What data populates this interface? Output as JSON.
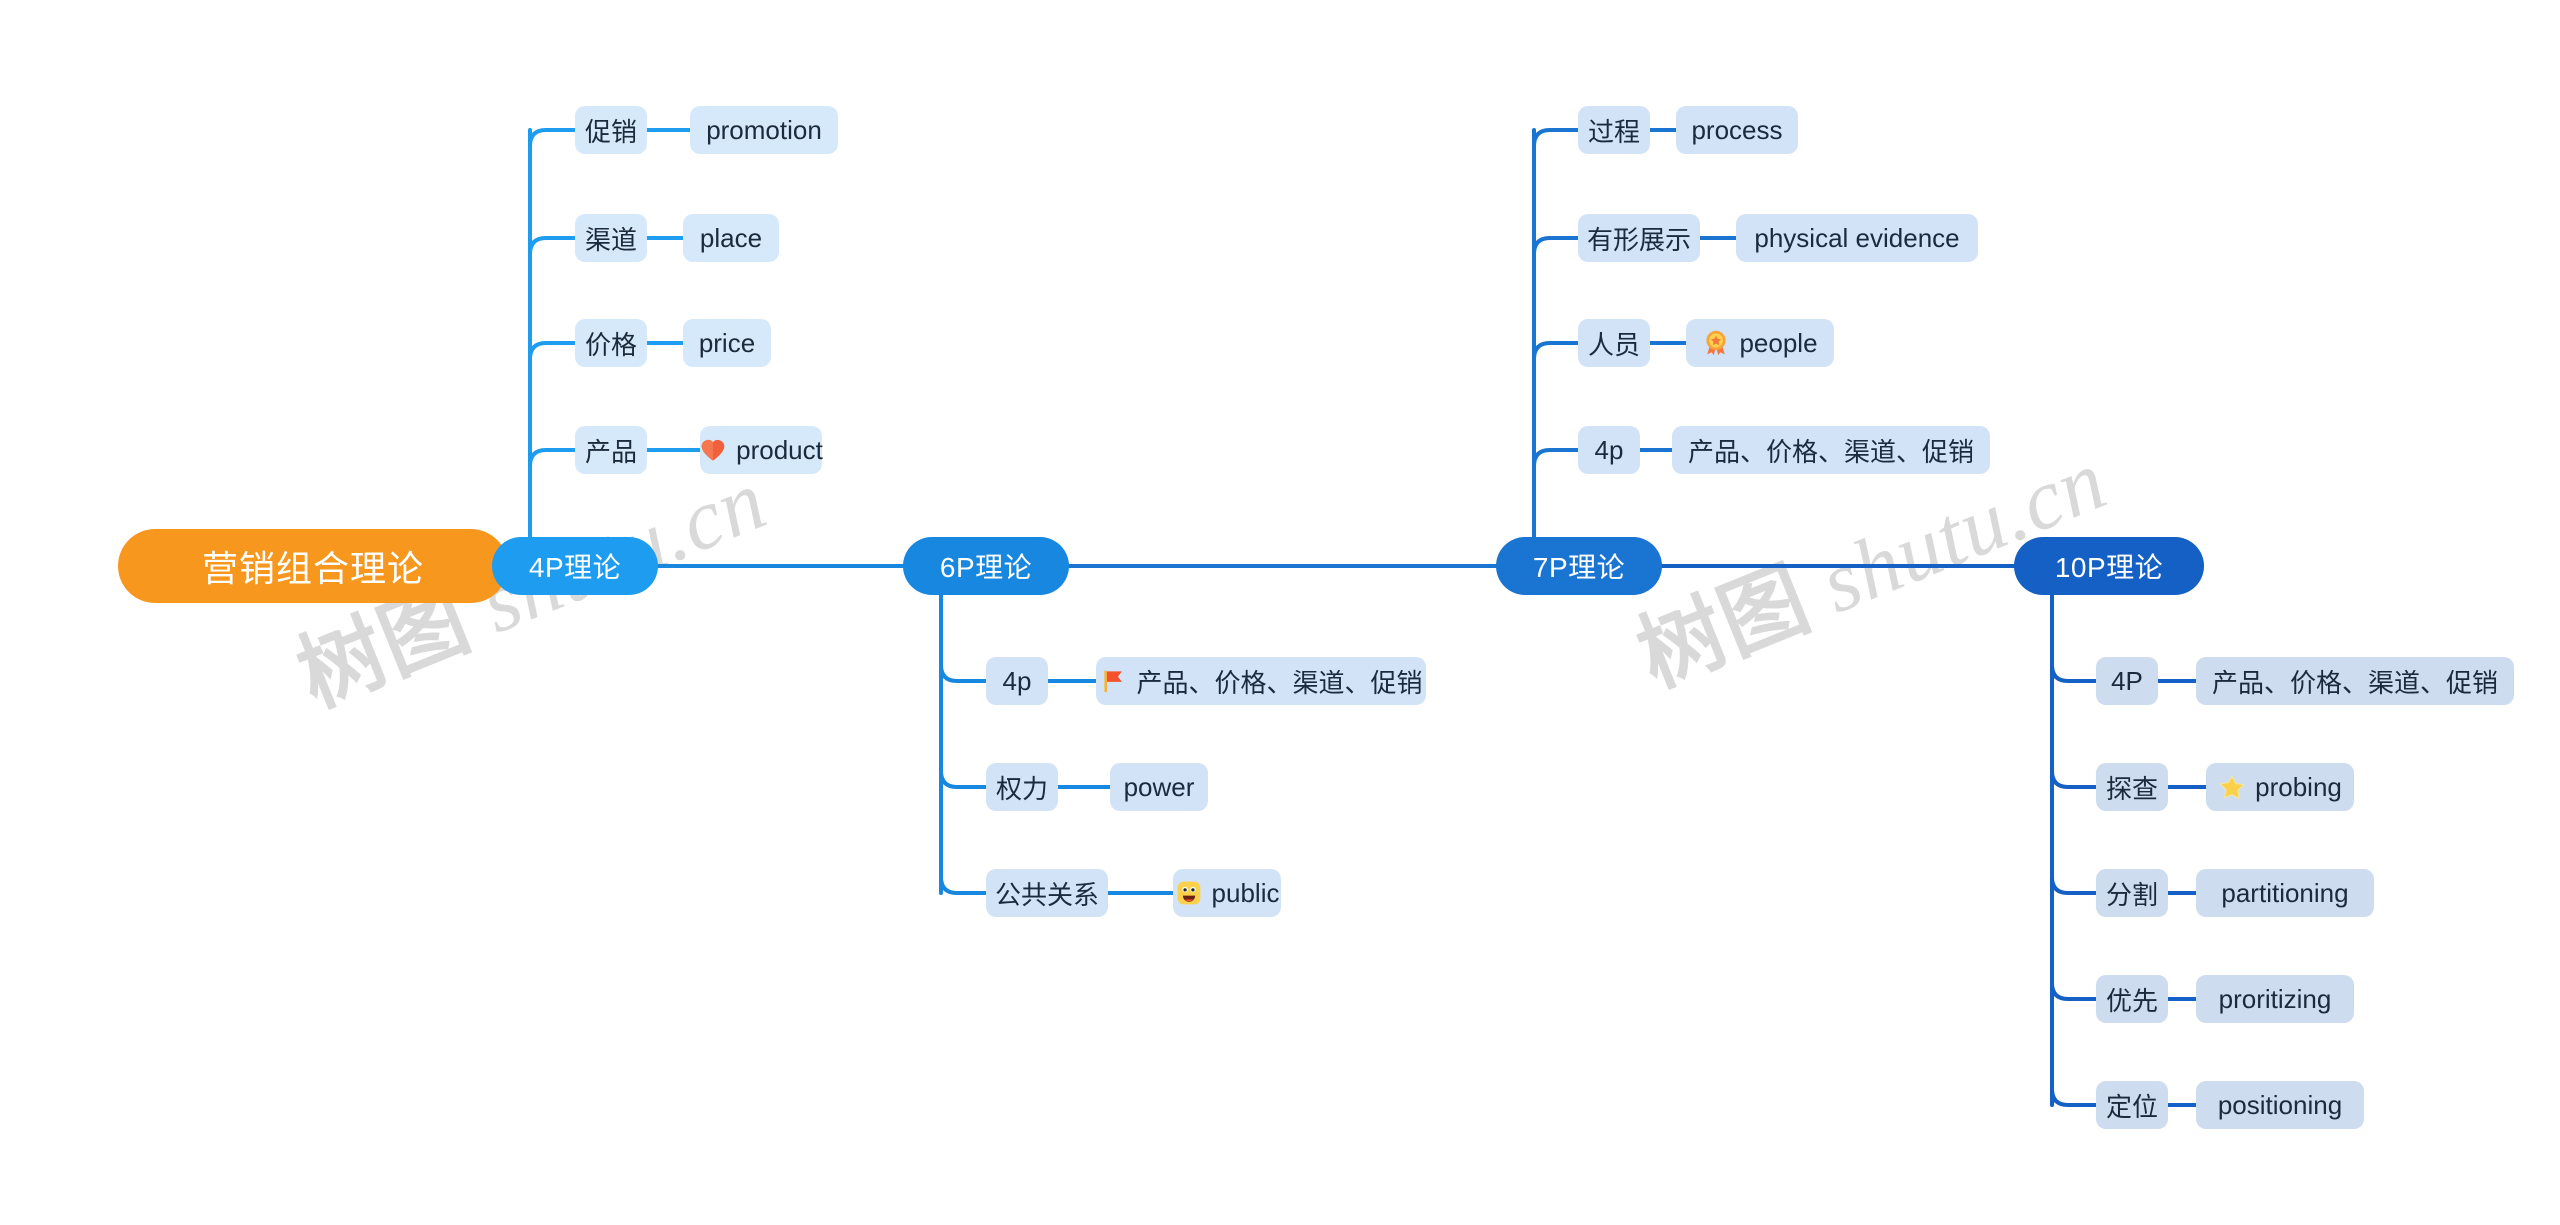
{
  "title": "营销组合理论",
  "watermark": {
    "cn": "树图",
    "domain": "shutu.cn"
  },
  "colors": {
    "root_bg": "#F7971D",
    "branch_4p": "#1E9CF0",
    "branch_6p": "#1787E0",
    "branch_7p": "#1A74D2",
    "branch_10p": "#1560C4",
    "leaf_light": "#D6E9FB",
    "leaf_mid": "#D3E3F7",
    "leaf_dark": "#CEDCEF",
    "link_4p": "#1E9CF0",
    "link_6p": "#1787E0",
    "link_7p": "#1A74D2",
    "link_10p": "#1560C4",
    "leaf_text": "#1b2a3d",
    "watermark": "#d9d9d9"
  },
  "root": {
    "label": "营销组合理论"
  },
  "branches": [
    {
      "id": "4p",
      "label": "4P理论",
      "children": [
        {
          "key": "促销",
          "value": "promotion",
          "emoji": null
        },
        {
          "key": "渠道",
          "value": "place",
          "emoji": null
        },
        {
          "key": "价格",
          "value": "price",
          "emoji": null
        },
        {
          "key": "产品",
          "value": "product",
          "emoji": "heart-emoji"
        }
      ]
    },
    {
      "id": "6p",
      "label": "6P理论",
      "children": [
        {
          "key": "4p",
          "value": "产品、价格、渠道、促销",
          "emoji": "flag-emoji"
        },
        {
          "key": "权力",
          "value": "power",
          "emoji": null
        },
        {
          "key": "公共关系",
          "value": "public",
          "emoji": "smiling-face-emoji"
        }
      ]
    },
    {
      "id": "7p",
      "label": "7P理论",
      "children": [
        {
          "key": "过程",
          "value": "process",
          "emoji": null
        },
        {
          "key": "有形展示",
          "value": "physical evidence",
          "emoji": null
        },
        {
          "key": "人员",
          "value": "people",
          "emoji": "rosette-emoji"
        },
        {
          "key": "4p",
          "value": "产品、价格、渠道、促销",
          "emoji": null
        }
      ]
    },
    {
      "id": "10p",
      "label": "10P理论",
      "children": [
        {
          "key": "4P",
          "value": "产品、价格、渠道、促销",
          "emoji": null
        },
        {
          "key": "探查",
          "value": "probing",
          "emoji": "star-emoji"
        },
        {
          "key": "分割",
          "value": "partitioning",
          "emoji": null
        },
        {
          "key": "优先",
          "value": "proritizing",
          "emoji": null
        },
        {
          "key": "定位",
          "value": "positioning",
          "emoji": null
        }
      ]
    }
  ]
}
